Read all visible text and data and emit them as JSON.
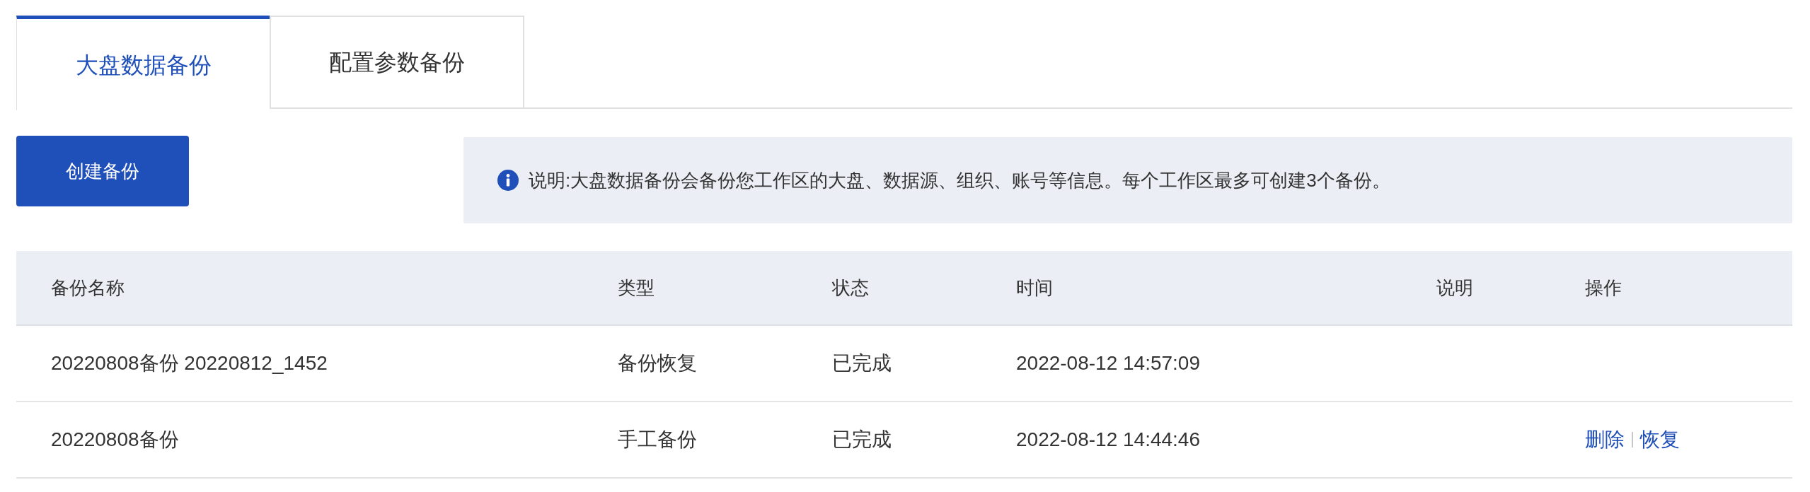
{
  "tabs": [
    {
      "label": "大盘数据备份",
      "selected": true
    },
    {
      "label": "配置参数备份",
      "selected": false
    }
  ],
  "create_button": "创建备份",
  "notice": "说明:大盘数据备份会备份您工作区的大盘、数据源、组织、账号等信息。每个工作区最多可创建3个备份。",
  "table": {
    "columns": [
      "备份名称",
      "类型",
      "状态",
      "时间",
      "说明",
      "操作"
    ],
    "rows": [
      {
        "name": "20220808备份 20220812_1452",
        "type": "备份恢复",
        "status": "已完成",
        "time": "2022-08-12 14:57:09",
        "actions": []
      },
      {
        "name": "20220808备份",
        "type": "手工备份",
        "status": "已完成",
        "time": "2022-08-12 14:44:46",
        "actions": [
          "删除",
          "恢复"
        ]
      }
    ]
  }
}
